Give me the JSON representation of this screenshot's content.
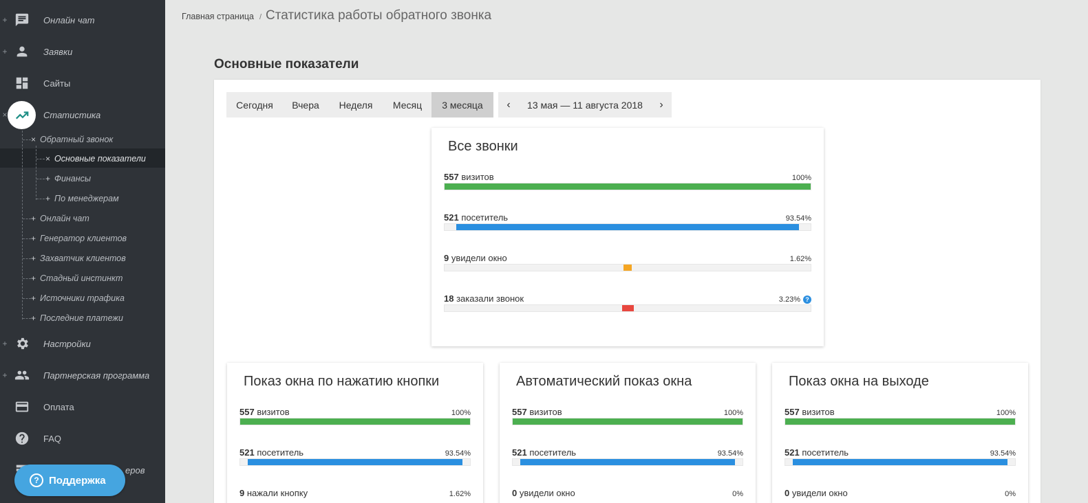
{
  "sidebar": {
    "top_items": [
      {
        "label": "Онлайн чат",
        "icon": "chat-icon",
        "marker": "+"
      },
      {
        "label": "Заявки",
        "icon": "person-icon",
        "marker": "+"
      },
      {
        "label": "Сайты",
        "icon": "dashboard-icon",
        "marker": ""
      },
      {
        "label": "Статистика",
        "icon": "trending-up-icon",
        "marker": "×"
      }
    ],
    "sub_items": [
      {
        "label": "Обратный звонок",
        "marker": "×"
      },
      {
        "label": "Основные показатели",
        "marker": "×"
      },
      {
        "label": "Финансы",
        "marker": "+"
      },
      {
        "label": "По менеджерам",
        "marker": "+"
      },
      {
        "label": "Онлайн чат",
        "marker": "+"
      },
      {
        "label": "Генератор клиентов",
        "marker": "+"
      },
      {
        "label": "Захватчик клиентов",
        "marker": "+"
      },
      {
        "label": "Стадный инстинкт",
        "marker": "+"
      },
      {
        "label": "Источники трафика",
        "marker": "+"
      },
      {
        "label": "Последние платежи",
        "marker": "+"
      }
    ],
    "bottom_items": [
      {
        "label": "Настройки",
        "icon": "gear-icon",
        "marker": "+"
      },
      {
        "label": "Партнерская программа",
        "icon": "people-icon",
        "marker": "+"
      },
      {
        "label": "Оплата",
        "icon": "card-icon",
        "marker": ""
      },
      {
        "label": "FAQ",
        "icon": "help-icon",
        "marker": ""
      },
      {
        "label": "еров",
        "icon": "list-icon",
        "marker": ""
      }
    ],
    "support_label": "Поддержка"
  },
  "breadcrumb": {
    "home": "Главная страница",
    "separator": "/",
    "current": "Статистика работы обратного звонка"
  },
  "page_title": "Основные показатели",
  "period_tabs": [
    {
      "label": "Сегодня",
      "selected": false
    },
    {
      "label": "Вчера",
      "selected": false
    },
    {
      "label": "Неделя",
      "selected": false
    },
    {
      "label": "Месяц",
      "selected": false
    },
    {
      "label": "3 месяца",
      "selected": true
    }
  ],
  "date_nav": {
    "prev": "‹",
    "range": "13 мая — 11 августа 2018",
    "next": "›"
  },
  "cards": {
    "all_calls": {
      "title": "Все звонки",
      "metrics": [
        {
          "count": "557",
          "text": "визитов",
          "pct": "100%",
          "color": "#4caf50",
          "level": 1.0,
          "help": false
        },
        {
          "count": "521",
          "text": "посетитель",
          "pct": "93.54%",
          "color": "#2a8fe0",
          "level": 0.9354,
          "help": false
        },
        {
          "count": "9",
          "text": "увидели окно",
          "pct": "1.62%",
          "color": "#f5a623",
          "level": 0.0162,
          "help": false
        },
        {
          "count": "18",
          "text": "заказали звонок",
          "pct": "3.23%",
          "color": "#e8473f",
          "level": 0.0323,
          "help": true
        }
      ]
    },
    "button_click": {
      "title": "Показ окна по нажатию кнопки",
      "metrics": [
        {
          "count": "557",
          "text": "визитов",
          "pct": "100%",
          "color": "#4caf50",
          "level": 1.0
        },
        {
          "count": "521",
          "text": "посетитель",
          "pct": "93.54%",
          "color": "#2a8fe0",
          "level": 0.9354
        },
        {
          "count": "9",
          "text": "нажали кнопку",
          "pct": "1.62%"
        }
      ]
    },
    "auto_show": {
      "title": "Автоматический показ окна",
      "metrics": [
        {
          "count": "557",
          "text": "визитов",
          "pct": "100%",
          "color": "#4caf50",
          "level": 1.0
        },
        {
          "count": "521",
          "text": "посетитель",
          "pct": "93.54%",
          "color": "#2a8fe0",
          "level": 0.9354
        },
        {
          "count": "0",
          "text": "увидели окно",
          "pct": "0%"
        }
      ]
    },
    "exit_show": {
      "title": "Показ окна на выходе",
      "metrics": [
        {
          "count": "557",
          "text": "визитов",
          "pct": "100%",
          "color": "#4caf50",
          "level": 1.0
        },
        {
          "count": "521",
          "text": "посетитель",
          "pct": "93.54%",
          "color": "#2a8fe0",
          "level": 0.9354
        },
        {
          "count": "0",
          "text": "увидели окно",
          "pct": "0%"
        }
      ]
    }
  }
}
